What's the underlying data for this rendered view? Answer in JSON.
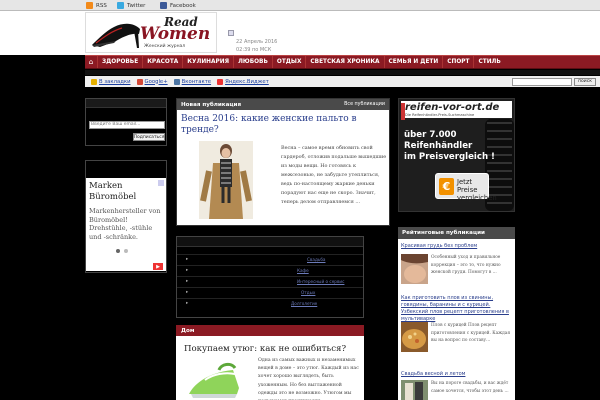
{
  "topbar": {
    "rss": "RSS",
    "twitter": "Twitter",
    "facebook": "Facebook"
  },
  "logo": {
    "read": "Read",
    "women": "Women",
    "subtitle": "Женский журнал"
  },
  "header": {
    "date": "22 Апрель 2016",
    "time": "02:39 по МСК"
  },
  "nav": {
    "home_icon": "home-icon",
    "items": [
      "ЗДОРОВЬЕ",
      "КРАСОТА",
      "КУЛИНАРИЯ",
      "ЛЮБОВЬ",
      "ОТДЫХ",
      "СВЕТСКАЯ ХРОНИКА",
      "СЕМЬЯ И ДЕТИ",
      "СПОРТ",
      "СТИЛЬ"
    ]
  },
  "utilbar": {
    "bookmarks": "В закладки",
    "google": "Google+",
    "vk": "Вконтакте",
    "yandex": "Яндекс.Виджет"
  },
  "search": {
    "button": "поиск"
  },
  "login": {
    "placeholder": "Введите Ваш email...",
    "button": "Подписаться"
  },
  "left_ad": {
    "title": "Marken Büromöbel",
    "text": "Markenhersteller von Büromöbel! Drehstühle, -stühle und -schränke."
  },
  "publication": {
    "header": "Новая публикация",
    "all_link": "Все публикации",
    "title": "Весна 2016: какие женские пальто в тренде?",
    "excerpt": "Весна – самое время обновить свой гардероб, отложив подальше вышедшие из моды вещи. Но готовясь к межсезонью, не забудьте утеплиться, ведь по-настоящему жаркие деньки порадуют нас еще не скоро. Значит, теперь делом отправляемся ..."
  },
  "links_box": {
    "items": [
      "Свадьба",
      "Кафе",
      "Интересный о сервис",
      "Отдых",
      "Долголетие"
    ]
  },
  "home_section": {
    "header": "Дом",
    "title": "Покупаем утюг: как не ошибиться?",
    "excerpt": "Одна из самых важных и незаменимых вещей в доме – это утюг. Каждый из нас хочет хорошо выглядеть, быть ухоженным. Но без выглаженной одежды это не возможно. Утюгом мы пользуемся практически"
  },
  "right_ad": {
    "brand": "reifen-vor-ort.de",
    "brand_sub": "Die Reifenhändler-Preis-Suchmaschine",
    "text_1": "über 7.000",
    "text_2": "Reifenhändler",
    "text_3": "im Preisvergleich !",
    "button": "Jetzt Preise vergleichen"
  },
  "rated": {
    "header": "Рейтинговые публикации",
    "items": [
      {
        "link": "Красивая грудь без проблем",
        "text": "Особенный уход и правильное коррекция – это то, что нужно женской груди. Помогут в ..."
      },
      {
        "link": "Как приготовить плов из свинины, говядины, баранины и с курицей. Узбекский плов рецепт приготовления в мультиварке",
        "text": "Плов с курицей Плов рецепт приготовления с курицей. Каждая вы на вопрос по составу..."
      },
      {
        "link": "Свадьба весной и летом",
        "text": "Вы на пороге свадьбы, и вас ждёт самое хочется, чтобы этот день ..."
      }
    ]
  }
}
